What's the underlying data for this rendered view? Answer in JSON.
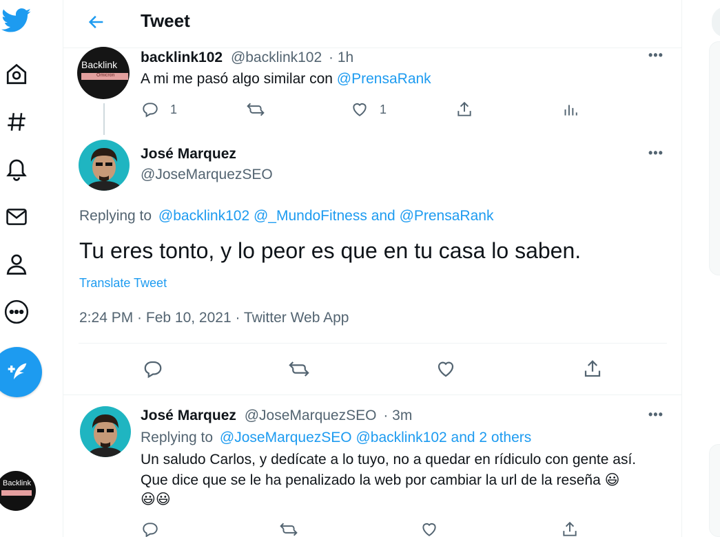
{
  "nav": {
    "icons": [
      "twitter-bird-icon",
      "home-icon",
      "explore-hashtag-icon",
      "notifications-bell-icon",
      "messages-mail-icon",
      "profile-icon",
      "more-icon",
      "compose-tweet-icon"
    ],
    "account_avatar_text": "Backlink"
  },
  "header": {
    "title": "Tweet"
  },
  "parent_tweet": {
    "avatar_text": "Backlink",
    "avatar_sub": "Ömicron",
    "name": "backlink102",
    "handle": "@backlink102",
    "time": "· 1h",
    "text_prefix": "A mi me pasó algo similar con ",
    "mention": "@PrensaRank",
    "replies": "1",
    "likes": "1"
  },
  "main_tweet": {
    "name": "José Marquez",
    "handle": "@JoseMarquezSEO",
    "replying_to_label": "Replying to",
    "replying_mentions": "@backlink102 @_MundoFitness and @PrensaRank",
    "text": "Tu eres tonto, y lo peor es que en tu casa lo saben.",
    "translate": "Translate Tweet",
    "timestamp": "2:24 PM · Feb 10, 2021 · Twitter Web App"
  },
  "reply_tweet": {
    "name": "José Marquez",
    "handle": "@JoseMarquezSEO",
    "time": "· 3m",
    "replying_to_label": "Replying to",
    "replying_mentions": "@JoseMarquezSEO @backlink102 and 2 others",
    "line1": "Un saludo Carlos, y dedícate a lo tuyo, no a quedar en rídiculo con gente así.",
    "line2": "Que dice que se le ha penalizado la web por cambiar la url de la reseña 😃",
    "line3": "😃😃"
  },
  "more_menu": "•••",
  "colors": {
    "accent": "#1d9bf0",
    "text": "#0f1419",
    "muted": "#536471",
    "border": "#eff3f4"
  }
}
